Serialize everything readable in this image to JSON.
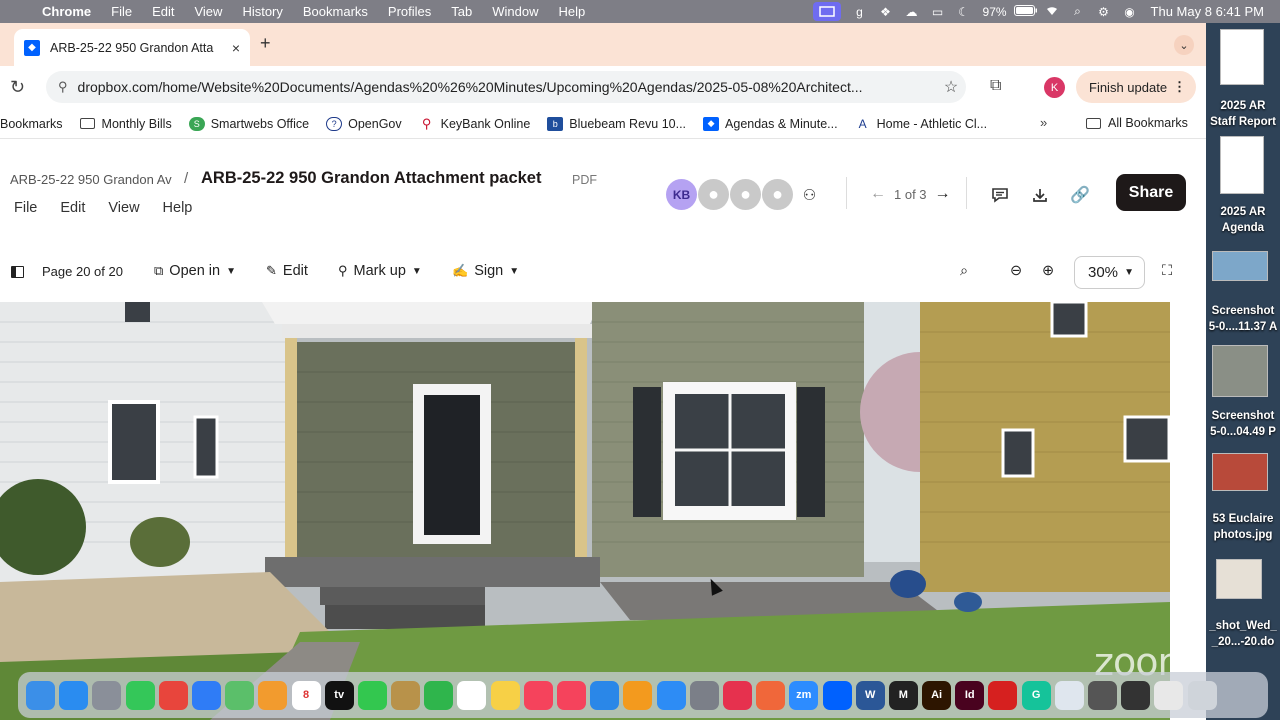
{
  "menubar": {
    "app": "Chrome",
    "items": [
      "File",
      "Edit",
      "View",
      "History",
      "Bookmarks",
      "Profiles",
      "Tab",
      "Window",
      "Help"
    ],
    "battery": "97%",
    "clock": "Thu May 8  6:41 PM"
  },
  "tab": {
    "title": "ARB-25-22 950 Grandon Atta",
    "close": "×",
    "new": "+"
  },
  "toolbar": {
    "url": "dropbox.com/home/Website%20Documents/Agendas%20%26%20Minutes/Upcoming%20Agendas/2025-05-08%20Architect...",
    "profile_initial": "K",
    "finish_update": "Finish update"
  },
  "bookmarks": {
    "items": [
      {
        "label": "Bookmarks",
        "icon": "none",
        "color": ""
      },
      {
        "label": "Monthly Bills",
        "icon": "folder-icon",
        "color": ""
      },
      {
        "label": "Smartwebs Office",
        "icon": "smartwebs-icon",
        "color": "#3aa655"
      },
      {
        "label": "OpenGov",
        "icon": "opengov-icon",
        "color": "#1e3a8a"
      },
      {
        "label": "KeyBank Online",
        "icon": "keybank-icon",
        "color": "#c8102e"
      },
      {
        "label": "Bluebeam Revu 10...",
        "icon": "bluebeam-icon",
        "color": "#1f4e9c"
      },
      {
        "label": "Agendas & Minute...",
        "icon": "dropbox-icon",
        "color": "#0061fe"
      },
      {
        "label": "Home - Athletic Cl...",
        "icon": "athletic-icon",
        "color": "#1d3c8f"
      }
    ],
    "more": "»",
    "all": "All Bookmarks"
  },
  "dropbox": {
    "breadcrumb": "ARB-25-22 950 Grandon Av",
    "separator": "/",
    "file_title": "ARB-25-22 950 Grandon Attachment packet",
    "file_type": "PDF",
    "menu": [
      "File",
      "Edit",
      "View",
      "Help"
    ],
    "avatar_initials": "KB",
    "pager": "1 of 3",
    "share": "Share",
    "page_indicator": "Page 20 of 20",
    "tools": {
      "open_in": "Open in",
      "edit": "Edit",
      "mark_up": "Mark up",
      "sign": "Sign"
    },
    "zoom": "30%"
  },
  "desktop": {
    "files": [
      {
        "label": "2025 AR"
      },
      {
        "label": "Staff Report"
      },
      {
        "label": "2025 AR"
      },
      {
        "label": "Agenda"
      },
      {
        "label": "Screenshot"
      },
      {
        "label": "5-0....11.37 A"
      },
      {
        "label": "Screenshot"
      },
      {
        "label": "5-0...04.49 P"
      },
      {
        "label": "53 Euclaire"
      },
      {
        "label": "photos.jpg"
      },
      {
        "label": "_shot_Wed_"
      },
      {
        "label": "_20...-20.do"
      }
    ]
  },
  "dock": {
    "apps": [
      {
        "name": "finder",
        "color": "#3b8fe8",
        "glyph": ""
      },
      {
        "name": "safari",
        "color": "#2a8cf0",
        "glyph": ""
      },
      {
        "name": "launchpad",
        "color": "#8a8f99",
        "glyph": ""
      },
      {
        "name": "messages",
        "color": "#34c759",
        "glyph": ""
      },
      {
        "name": "chrome",
        "color": "#e8453c",
        "glyph": ""
      },
      {
        "name": "mail",
        "color": "#2f7cf6",
        "glyph": ""
      },
      {
        "name": "maps",
        "color": "#5bbf6a",
        "glyph": ""
      },
      {
        "name": "photos",
        "color": "#f29b2e",
        "glyph": ""
      },
      {
        "name": "calendar",
        "color": "#ffffff",
        "glyph": "8"
      },
      {
        "name": "tv",
        "color": "#111111",
        "glyph": "tv"
      },
      {
        "name": "facetime",
        "color": "#33c74f",
        "glyph": ""
      },
      {
        "name": "files",
        "color": "#b8924a",
        "glyph": ""
      },
      {
        "name": "numbers",
        "color": "#2fb54c",
        "glyph": ""
      },
      {
        "name": "reminders",
        "color": "#ffffff",
        "glyph": ""
      },
      {
        "name": "notes",
        "color": "#f7d046",
        "glyph": ""
      },
      {
        "name": "music",
        "color": "#f5435c",
        "glyph": ""
      },
      {
        "name": "news",
        "color": "#f5435c",
        "glyph": ""
      },
      {
        "name": "keynote",
        "color": "#2a87e8",
        "glyph": ""
      },
      {
        "name": "pages",
        "color": "#f39a1e",
        "glyph": ""
      },
      {
        "name": "app-store",
        "color": "#2d8cf5",
        "glyph": ""
      },
      {
        "name": "settings",
        "color": "#7b7f88",
        "glyph": ""
      },
      {
        "name": "creative-cloud",
        "color": "#e6314e",
        "glyph": ""
      },
      {
        "name": "app-grid",
        "color": "#f0673a",
        "glyph": ""
      },
      {
        "name": "zoom",
        "color": "#2d8cff",
        "glyph": "zm"
      },
      {
        "name": "dropbox",
        "color": "#0061fe",
        "glyph": ""
      },
      {
        "name": "word",
        "color": "#2b5797",
        "glyph": "W"
      },
      {
        "name": "mstudio",
        "color": "#222222",
        "glyph": "M"
      },
      {
        "name": "illustrator",
        "color": "#2d1500",
        "glyph": "Ai"
      },
      {
        "name": "indesign",
        "color": "#49021f",
        "glyph": "Id"
      },
      {
        "name": "acrobat",
        "color": "#d6201f",
        "glyph": ""
      },
      {
        "name": "grammarly",
        "color": "#15c39a",
        "glyph": "G"
      },
      {
        "name": "preview",
        "color": "#dfe6ee",
        "glyph": ""
      },
      {
        "name": "calculator",
        "color": "#555555",
        "glyph": ""
      },
      {
        "name": "downloads",
        "color": "#333333",
        "glyph": ""
      },
      {
        "name": "stack",
        "color": "#e8e8e8",
        "glyph": ""
      },
      {
        "name": "trash",
        "color": "#cfd4da",
        "glyph": ""
      }
    ]
  },
  "watermark": "zoom"
}
